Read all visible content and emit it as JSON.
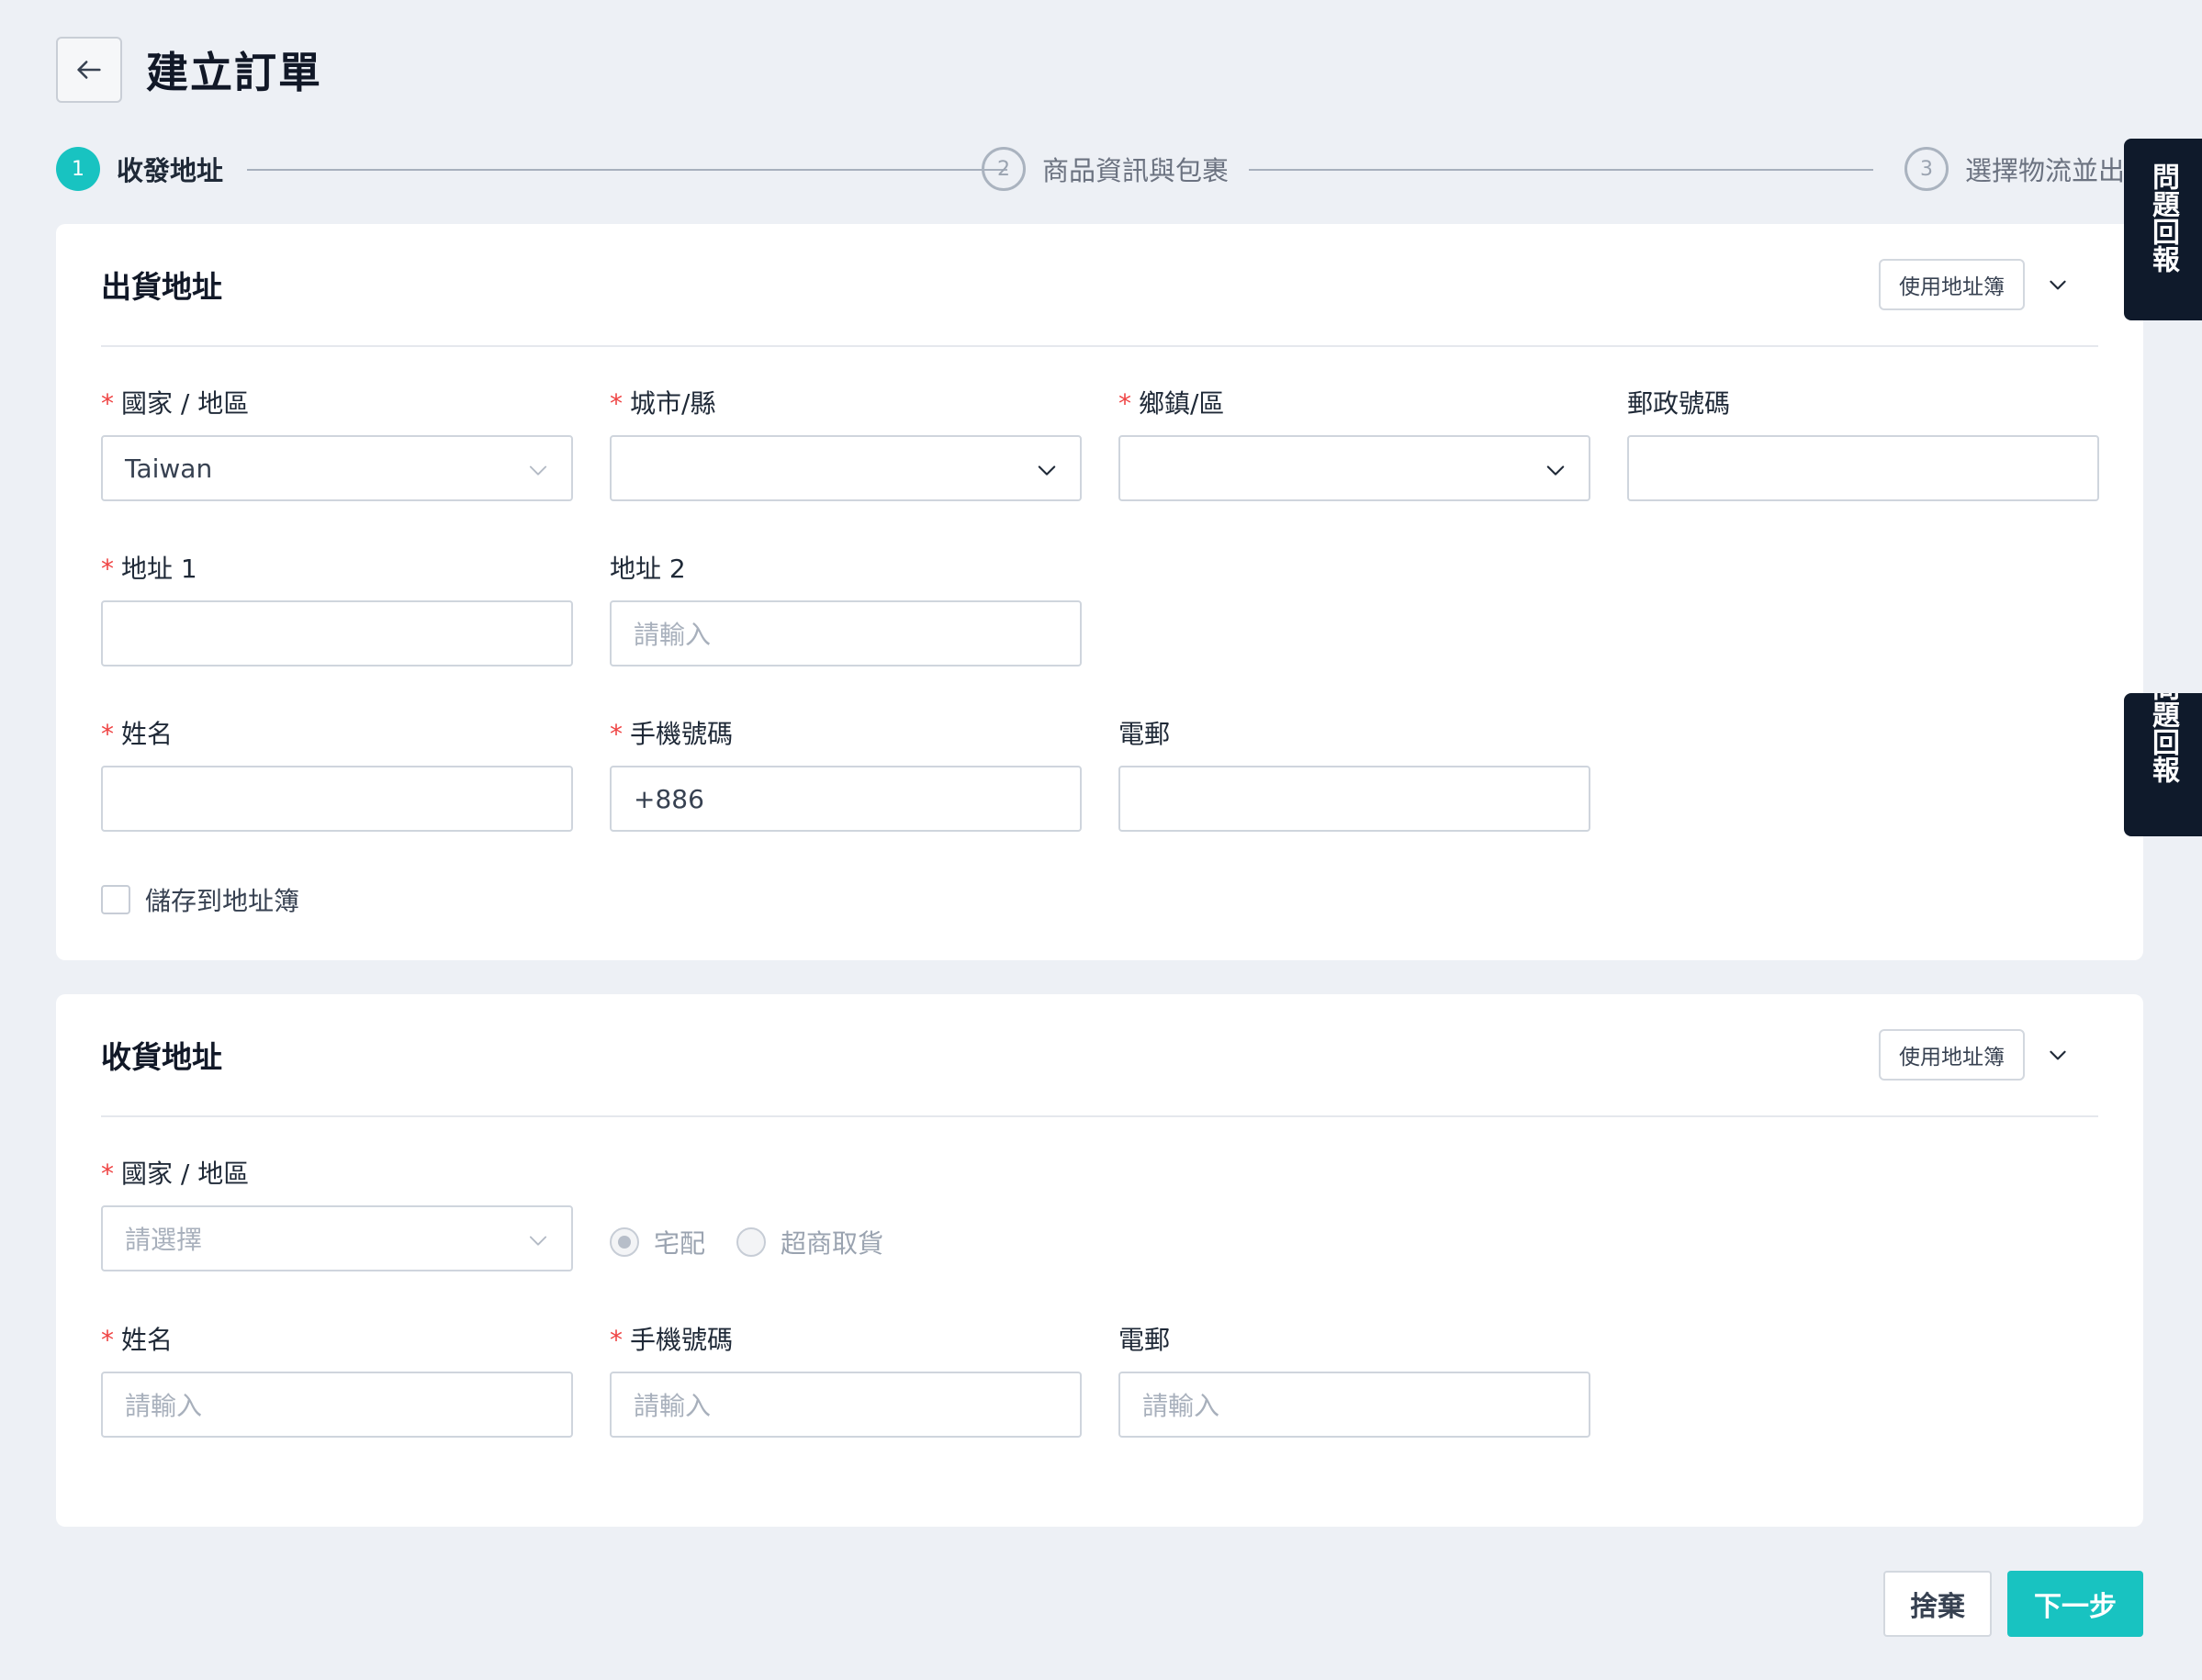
{
  "header": {
    "title": "建立訂單"
  },
  "steps": [
    {
      "number": "1",
      "label": "收發地址"
    },
    {
      "number": "2",
      "label": "商品資訊與包裹"
    },
    {
      "number": "3",
      "label": "選擇物流並出貨"
    }
  ],
  "feedback": {
    "label": "問題回報"
  },
  "sender": {
    "title": "出貨地址",
    "address_book_label": "使用地址簿",
    "country_label": "國家 / 地區",
    "country_value": "Taiwan",
    "city_label": "城市/縣",
    "district_label": "鄉鎮/區",
    "postal_label": "郵政號碼",
    "address1_label": "地址 1",
    "address2_label": "地址 2",
    "address2_placeholder": "請輸入",
    "name_label": "姓名",
    "mobile_label": "手機號碼",
    "mobile_value": "+886",
    "email_label": "電郵",
    "save_label": "儲存到地址簿"
  },
  "receiver": {
    "title": "收貨地址",
    "address_book_label": "使用地址簿",
    "country_label": "國家 / 地區",
    "country_placeholder": "請選擇",
    "delivery_home_label": "宅配",
    "delivery_store_label": "超商取貨",
    "name_label": "姓名",
    "name_placeholder": "請輸入",
    "mobile_label": "手機號碼",
    "mobile_placeholder": "請輸入",
    "email_label": "電郵",
    "email_placeholder": "請輸入"
  },
  "footer": {
    "discard_label": "捨棄",
    "next_label": "下一步"
  },
  "colors": {
    "accent": "#18c3c1",
    "required": "#ef4444",
    "feedback_bg": "#0f1a2b"
  }
}
